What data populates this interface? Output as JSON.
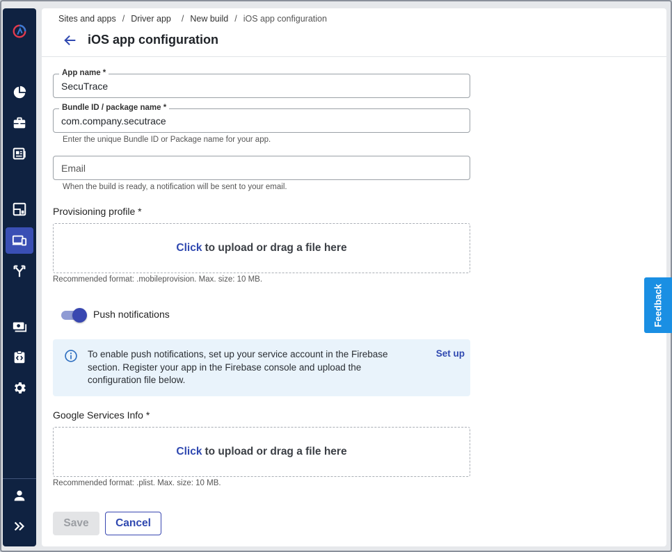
{
  "breadcrumbs": [
    "Sites and apps",
    "Driver app",
    "New build",
    "iOS app configuration"
  ],
  "page_title": "iOS app configuration",
  "fields": {
    "app_name": {
      "label": "App name *",
      "value": "SecuTrace"
    },
    "bundle_id": {
      "label": "Bundle ID / package name *",
      "value": "com.company.secutrace",
      "helper": "Enter the unique Bundle ID or Package name for your app."
    },
    "email": {
      "placeholder": "Email",
      "helper": "When the build is ready, a notification will be sent to your email."
    }
  },
  "provisioning": {
    "label": "Provisioning profile *",
    "click": "Click",
    "upload_text": "to upload or drag a file here",
    "recommended": "Recommended format: .mobileprovision. Max. size: 10 MB."
  },
  "push": {
    "label": "Push notifications",
    "enabled": true
  },
  "info_box": {
    "text": "To enable push notifications, set up your service account in the Firebase section. Register your app in the Firebase console and upload the configuration file below.",
    "action": "Set up"
  },
  "google_services": {
    "label": "Google Services Info *",
    "click": "Click",
    "upload_text": "to upload or drag a file here",
    "recommended": "Recommended format: .plist. Max. size: 10 MB."
  },
  "buttons": {
    "save": "Save",
    "cancel": "Cancel"
  },
  "feedback": "Feedback",
  "sidebar": {
    "icons": [
      "logo-icon",
      "dashboard-pie-icon",
      "briefcase-icon",
      "report-icon",
      "layout-icon",
      "devices-icon",
      "integrations-icon",
      "payments-icon",
      "developer-icon",
      "settings-icon",
      "user-icon",
      "expand-icon"
    ],
    "active": "devices-icon"
  },
  "colors": {
    "sidebar": "#0f2241",
    "accent": "#3847b0",
    "link": "#2f48b0",
    "info_bg": "#e9f3fb",
    "feedback": "#1a8fe3"
  }
}
